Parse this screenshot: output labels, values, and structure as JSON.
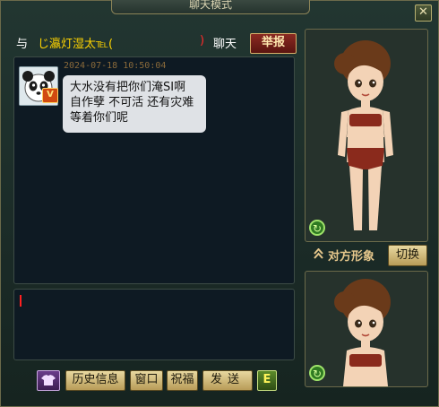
{
  "window": {
    "title": "聊天模式"
  },
  "header": {
    "with": "与",
    "player_name": "じ瀛灯湿太℡(",
    "paren_close": ")",
    "suffix": "聊天",
    "report_label": "举报"
  },
  "messages": [
    {
      "timestamp": "2024-07-18 10:50:04",
      "text": "大水没有把你们淹SI啊 自作孽 不可活 还有灾难等着你们呢",
      "badge": "V"
    }
  ],
  "toolbar": {
    "history_label": "历史信息",
    "window_label": "窗口",
    "bless_label": "祝福",
    "send_label": "发送",
    "e_label": "E"
  },
  "character": {
    "other_label": "对方形象",
    "switch_label": "切换"
  },
  "colors": {
    "name": "#ffd400",
    "accent_red": "#ff2a2a",
    "bubble": "#dfe2e6"
  },
  "icons": {
    "close": "close-icon",
    "refresh": "refresh-icon",
    "wardrobe": "wardrobe-icon"
  }
}
